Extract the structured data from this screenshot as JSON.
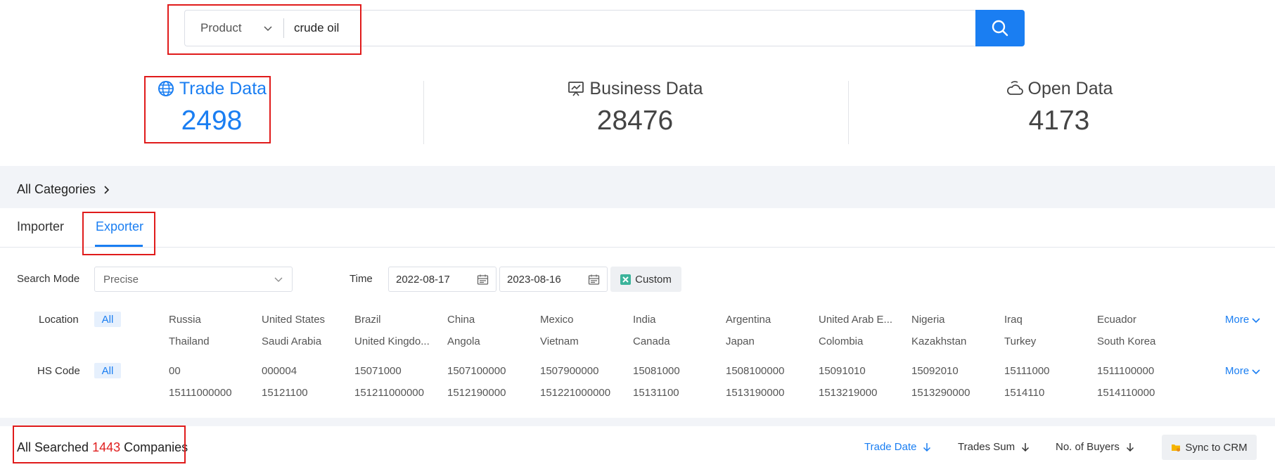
{
  "search": {
    "type_label": "Product",
    "query": "crude oil"
  },
  "stats": [
    {
      "label": "Trade Data",
      "value": "2498",
      "icon": "globe-icon"
    },
    {
      "label": "Business Data",
      "value": "28476",
      "icon": "presentation-chart-icon"
    },
    {
      "label": "Open Data",
      "value": "4173",
      "icon": "cloud-icon"
    }
  ],
  "categories": {
    "label": "All Categories"
  },
  "tabs": [
    {
      "label": "Importer",
      "active": false
    },
    {
      "label": "Exporter",
      "active": true
    }
  ],
  "filters": {
    "search_mode_label": "Search Mode",
    "search_mode_value": "Precise",
    "time_label": "Time",
    "date_from": "2022-08-17",
    "date_to": "2023-08-16",
    "custom_label": "Custom"
  },
  "location": {
    "label": "Location",
    "all": "All",
    "more": "More",
    "items": [
      "Russia",
      "United States",
      "Brazil",
      "China",
      "Mexico",
      "India",
      "Argentina",
      "United Arab E...",
      "Nigeria",
      "Iraq",
      "Ecuador",
      "Thailand",
      "Saudi Arabia",
      "United Kingdo...",
      "Angola",
      "Vietnam",
      "Canada",
      "Japan",
      "Colombia",
      "Kazakhstan",
      "Turkey",
      "South Korea"
    ]
  },
  "hs_code": {
    "label": "HS Code",
    "all": "All",
    "more": "More",
    "items": [
      "00",
      "000004",
      "15071000",
      "1507100000",
      "1507900000",
      "15081000",
      "1508100000",
      "15091010",
      "15092010",
      "15111000",
      "1511100000",
      "15111000000",
      "15121100",
      "151211000000",
      "1512190000",
      "151221000000",
      "15131100",
      "1513190000",
      "1513219000",
      "1513290000",
      "1514110",
      "1514110000"
    ]
  },
  "results": {
    "prefix": "All Searched",
    "count": "1443",
    "suffix": "Companies"
  },
  "sort": [
    {
      "label": "Trade Date",
      "active": true
    },
    {
      "label": "Trades Sum",
      "active": false
    },
    {
      "label": "No. of Buyers",
      "active": false
    }
  ],
  "sync_label": "Sync to CRM",
  "colors": {
    "accent": "#1a7ef2",
    "highlight": "#e01b1b",
    "count": "#e02020"
  }
}
